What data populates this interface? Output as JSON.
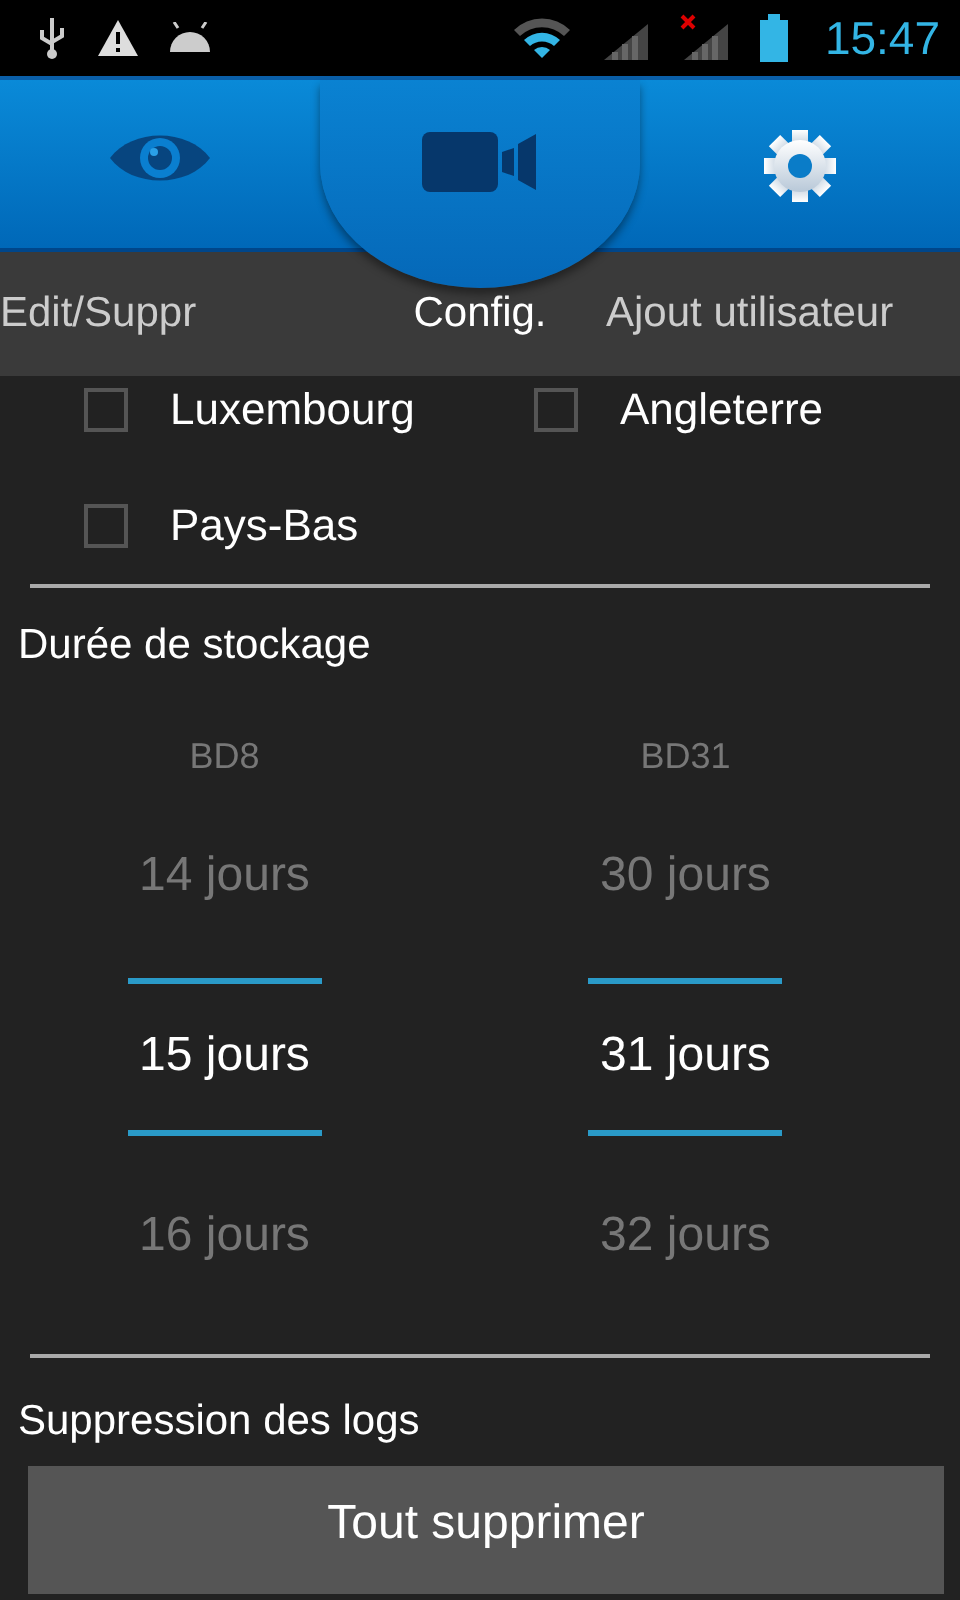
{
  "status_bar": {
    "time": "15:47"
  },
  "icon_tabs": [
    {
      "selected": false
    },
    {
      "selected": true
    },
    {
      "selected": false
    }
  ],
  "page_titles": [
    {
      "label": "Edit/Suppr",
      "selected": false
    },
    {
      "label": "Config.",
      "selected": true
    },
    {
      "label": "Ajout utilisateur",
      "selected": false
    }
  ],
  "countries": [
    {
      "label": "Luxembourg",
      "checked": false
    },
    {
      "label": "Angleterre",
      "checked": false
    },
    {
      "label": "Pays-Bas",
      "checked": false
    }
  ],
  "storage": {
    "title": "Durée de stockage",
    "pickers": [
      {
        "label": "BD8",
        "values": [
          {
            "text": "14 jours",
            "selected": false
          },
          {
            "text": "15 jours",
            "selected": true
          },
          {
            "text": "16 jours",
            "selected": false
          }
        ]
      },
      {
        "label": "BD31",
        "values": [
          {
            "text": "30 jours",
            "selected": false
          },
          {
            "text": "31 jours",
            "selected": true
          },
          {
            "text": "32 jours",
            "selected": false
          }
        ]
      }
    ]
  },
  "logs": {
    "title": "Suppression des logs",
    "button": "Tout supprimer"
  }
}
